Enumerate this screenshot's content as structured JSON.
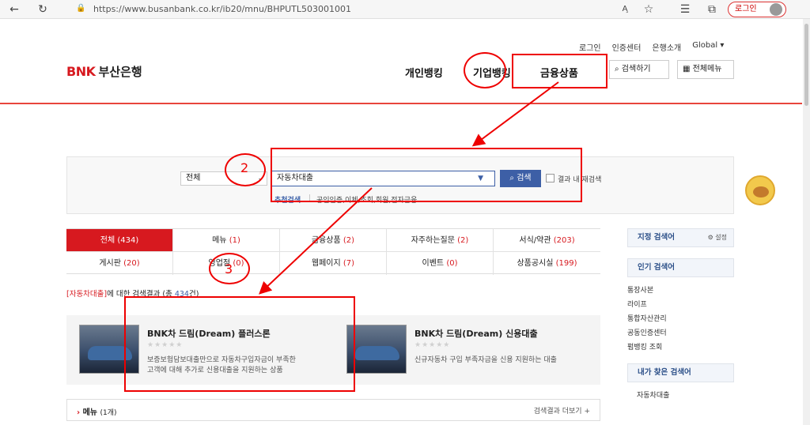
{
  "browser": {
    "url": "https://www.busanbank.co.kr/ib20/mnu/BHPUTL503001001",
    "login_label": "로그인",
    "reader_label": "A̧"
  },
  "header": {
    "utility": [
      "로그인",
      "인증센터",
      "은행소개",
      "Global ▾"
    ],
    "logo_bnk": "BNK",
    "logo_text": "부산은행",
    "gnb": [
      "개인뱅킹",
      "기업뱅킹",
      "금융상품"
    ],
    "search_btn": "검색하기",
    "menu_btn": "전체메뉴"
  },
  "search": {
    "select_value": "전체",
    "input_value": "자동차대출",
    "button_label": "검색",
    "checkbox_label": "결과 내 재검색",
    "recommend_label": "추천검색",
    "recommend_items": "공인인증,이체,조회,회원,전자금융"
  },
  "tabs": [
    {
      "label": "전체",
      "count": "(434)"
    },
    {
      "label": "메뉴",
      "count": "(1)"
    },
    {
      "label": "금융상품",
      "count": "(2)"
    },
    {
      "label": "자주하는질문",
      "count": "(2)"
    },
    {
      "label": "서식/약관",
      "count": "(203)"
    },
    {
      "label": "게시판",
      "count": "(20)"
    },
    {
      "label": "영업점",
      "count": "(0)"
    },
    {
      "label": "웹페이지",
      "count": "(7)"
    },
    {
      "label": "이벤트",
      "count": "(0)"
    },
    {
      "label": "상품공시실",
      "count": "(199)"
    }
  ],
  "result": {
    "keyword": "[자동차대출]",
    "text": "에 대한 검색결과 (총",
    "total": "434",
    "suffix": "건)"
  },
  "products": [
    {
      "title": "BNK차 드림(Dream) 플러스론",
      "stars": "★★★★★",
      "desc1": "보증보험담보대출만으로 자동차구입자금이 부족한",
      "desc2": "고객에 대해 추가로 신용대출을 지원하는 상품"
    },
    {
      "title": "BNK차 드림(Dream) 신용대출",
      "stars": "★★★★★",
      "desc1": "신규자동차 구입 부족자금을 신용 지원하는 대출",
      "desc2": ""
    }
  ],
  "menu_section": {
    "title": "메뉴",
    "count": "(1개)",
    "more": "검색결과 더보기 +"
  },
  "sidebar": {
    "designated_title": "지정 검색어",
    "settings": "⚙ 설정",
    "popular_title": "인기 검색어",
    "popular": [
      "통장사본",
      "라이프",
      "통합자산관리",
      "공동인증센터",
      "펌뱅킹 조회"
    ],
    "my_title": "내가 찾은 검색어",
    "my": [
      "자동차대출"
    ]
  },
  "annotations": {
    "n2": "2",
    "n3": "3"
  }
}
